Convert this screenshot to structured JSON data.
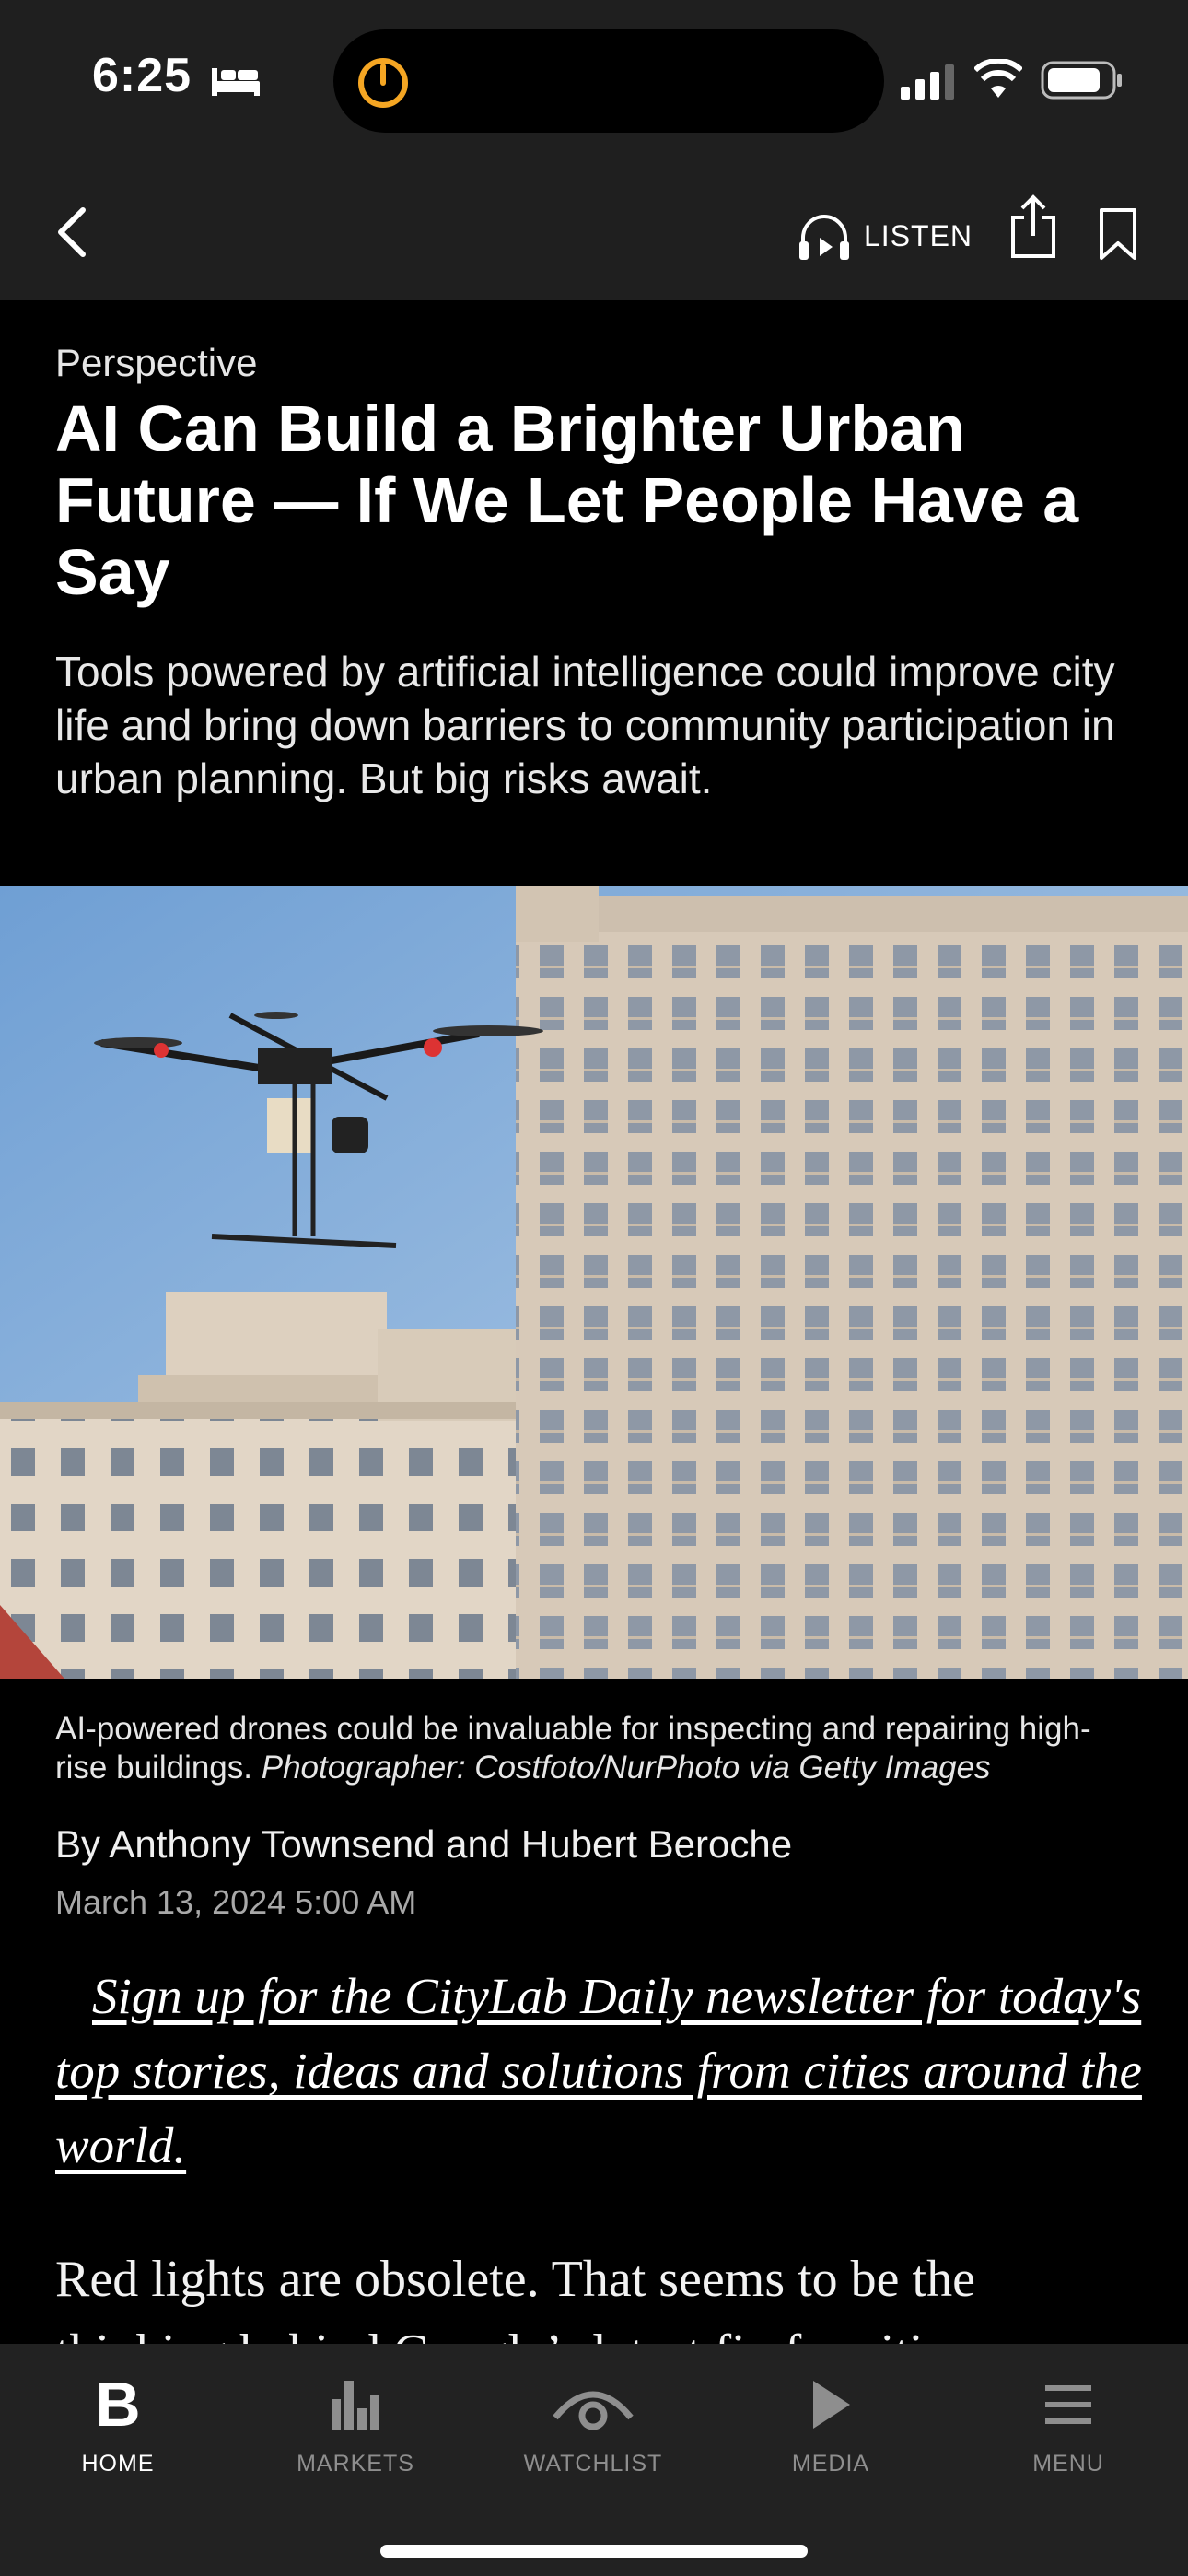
{
  "status_bar": {
    "time": "6:25",
    "icons": [
      "bed-icon",
      "timer-icon",
      "signal-icon",
      "wifi-icon",
      "battery-icon"
    ],
    "timer_color": "#f5a623"
  },
  "nav": {
    "listen_label": "LISTEN"
  },
  "article": {
    "kicker": "Perspective",
    "headline": "AI Can Build a Brighter Urban Future — If We Let People Have a Say",
    "dek": "Tools powered by artificial intelligence could improve city life and bring down barriers to community participation in urban planning. But big risks await.",
    "caption": "AI-powered drones could be invaluable for inspecting and repairing high-rise buildings.",
    "credit": "Photographer: Costfoto/NurPhoto via Getty Images",
    "byline": "By Anthony Townsend and Hubert Beroche",
    "date": "March 13, 2024 5:00 AM",
    "promo": "Sign up for the CityLab Daily newsletter for today's top stories, ideas and solutions from cities around the world.",
    "body_first_line": "Red lights are obsolete. That seems to be the",
    "body_second_line": "thinking behind Google’s latest fix for cities"
  },
  "tab_bar": {
    "items": [
      {
        "label": "HOME",
        "glyph": "B",
        "active": true
      },
      {
        "label": "MARKETS",
        "active": false
      },
      {
        "label": "WATCHLIST",
        "active": false
      },
      {
        "label": "MEDIA",
        "active": false
      },
      {
        "label": "MENU",
        "active": false
      }
    ]
  }
}
